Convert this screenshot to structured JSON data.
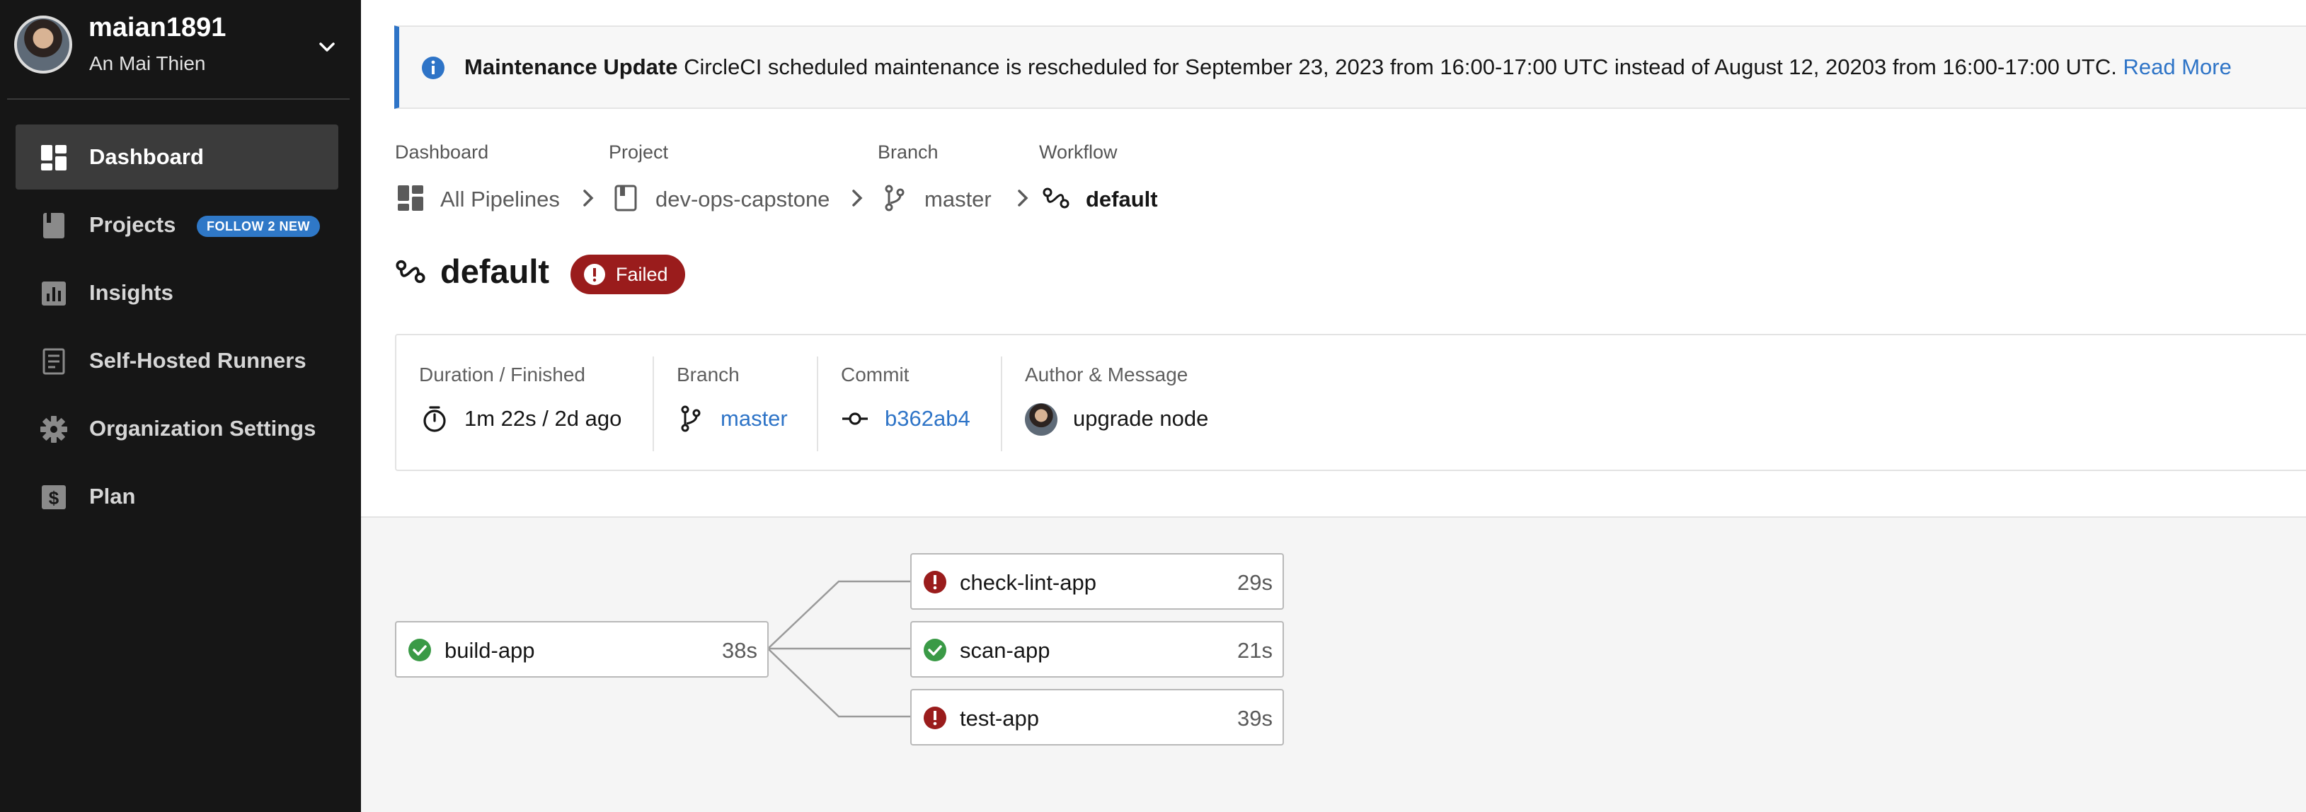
{
  "user": {
    "username": "maian1891",
    "full_name": "An Mai Thien"
  },
  "sidebar": {
    "items": [
      {
        "label": "Dashboard",
        "icon": "dashboard-icon",
        "active": true
      },
      {
        "label": "Projects",
        "icon": "projects-icon",
        "badge": "FOLLOW 2 NEW"
      },
      {
        "label": "Insights",
        "icon": "insights-icon"
      },
      {
        "label": "Self-Hosted Runners",
        "icon": "runners-icon"
      },
      {
        "label": "Organization Settings",
        "icon": "gear-icon"
      },
      {
        "label": "Plan",
        "icon": "dollar-icon"
      }
    ]
  },
  "banner": {
    "title": "Maintenance Update",
    "message": "CircleCI scheduled maintenance is rescheduled for September 23, 2023 from 16:00-17:00 UTC instead of August 12, 20203 from 16:00-17:00 UTC.",
    "link": "Read More",
    "icon": "info-icon"
  },
  "breadcrumb": [
    {
      "heading": "Dashboard",
      "label": "All Pipelines",
      "icon": "pipelines-icon"
    },
    {
      "heading": "Project",
      "label": "dev-ops-capstone",
      "icon": "project-icon"
    },
    {
      "heading": "Branch",
      "label": "master",
      "icon": "branch-icon"
    },
    {
      "heading": "Workflow",
      "label": "default",
      "icon": "workflow-icon"
    }
  ],
  "workflow": {
    "name": "default",
    "status": "Failed"
  },
  "info": {
    "duration_label": "Duration / Finished",
    "duration_value": "1m 22s / 2d ago",
    "branch_label": "Branch",
    "branch_value": "master",
    "commit_label": "Commit",
    "commit_value": "b362ab4",
    "author_label": "Author & Message",
    "author_message": "upgrade node"
  },
  "jobs": [
    {
      "name": "build-app",
      "duration": "38s",
      "status": "success"
    },
    {
      "name": "check-lint-app",
      "duration": "29s",
      "status": "failed"
    },
    {
      "name": "scan-app",
      "duration": "21s",
      "status": "success"
    },
    {
      "name": "test-app",
      "duration": "39s",
      "status": "failed"
    }
  ],
  "colors": {
    "sidebar_bg": "#161616",
    "accent_blue": "#2e74c7",
    "failed_red": "#9a1c1c",
    "success_green": "#3a9a46"
  }
}
